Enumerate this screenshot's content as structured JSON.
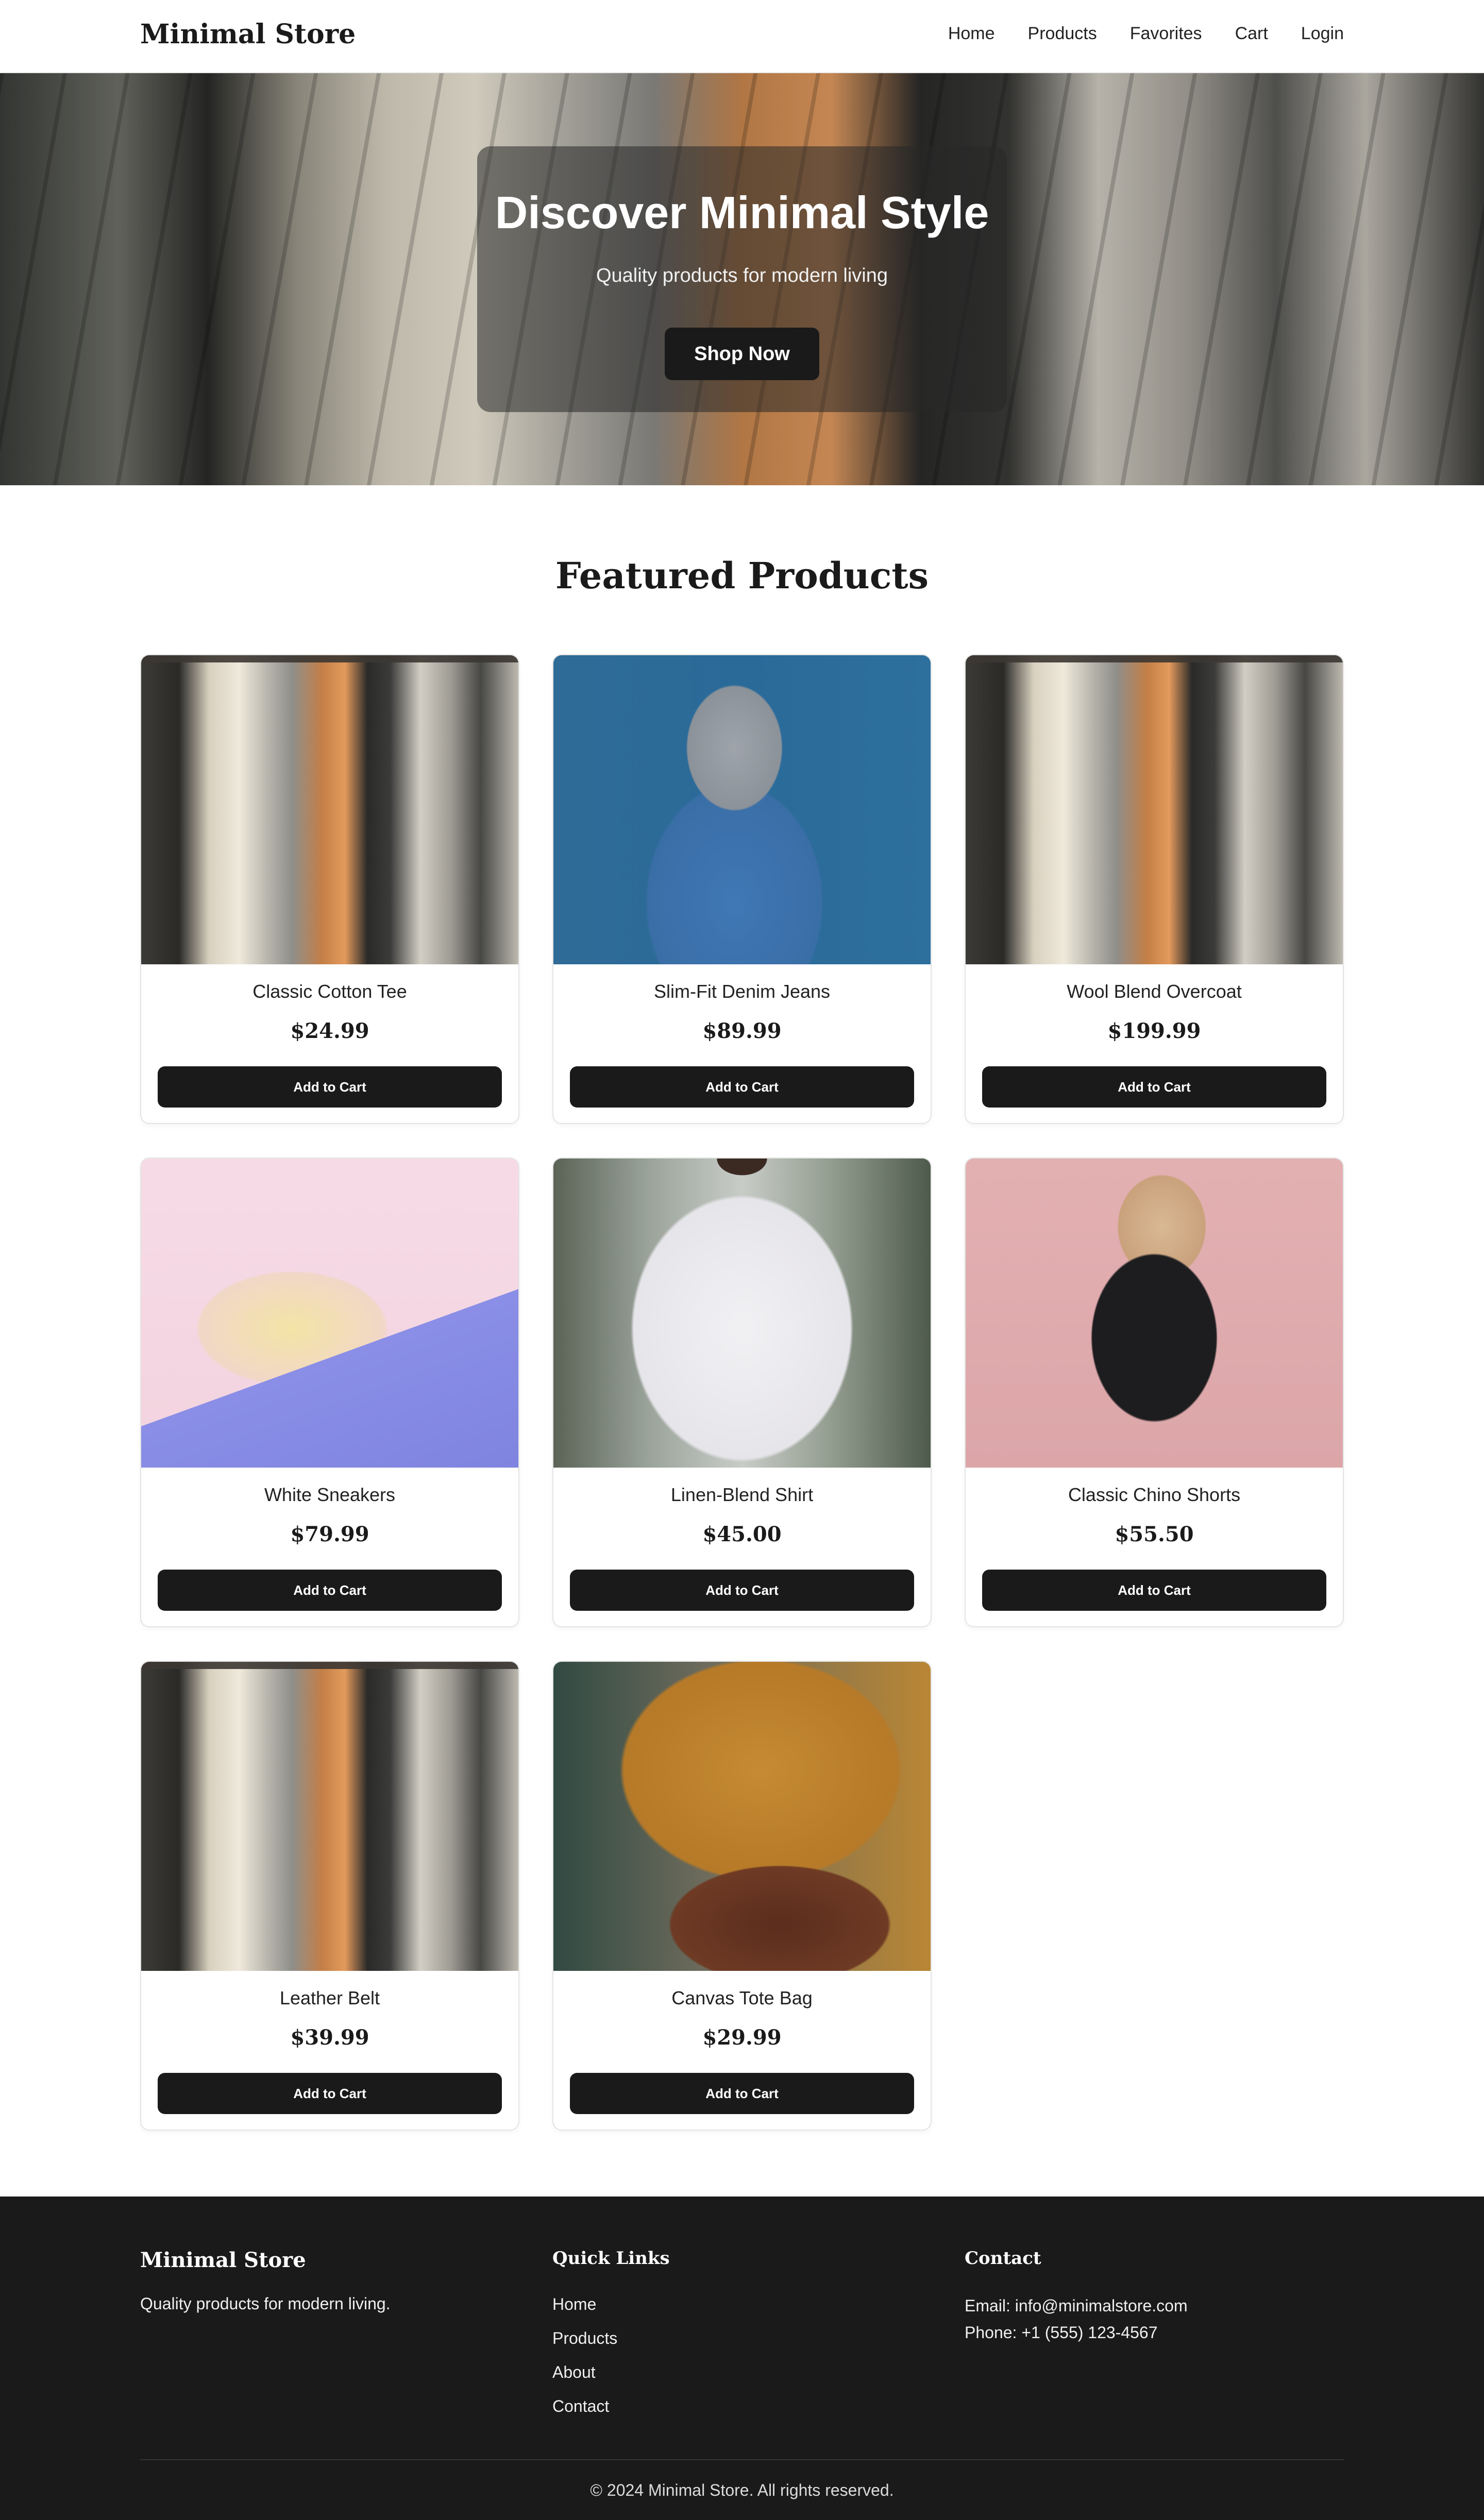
{
  "header": {
    "logo": "Minimal Store",
    "nav": [
      "Home",
      "Products",
      "Favorites",
      "Cart",
      "Login"
    ]
  },
  "hero": {
    "title": "Discover Minimal Style",
    "subtitle": "Quality products for modern living",
    "cta": "Shop Now"
  },
  "featured": {
    "title": "Featured Products",
    "products": [
      {
        "name": "Classic Cotton Tee",
        "price": "$24.99",
        "button": "Add to Cart"
      },
      {
        "name": "Slim-Fit Denim Jeans",
        "price": "$89.99",
        "button": "Add to Cart"
      },
      {
        "name": "Wool Blend Overcoat",
        "price": "$199.99",
        "button": "Add to Cart"
      },
      {
        "name": "White Sneakers",
        "price": "$79.99",
        "button": "Add to Cart"
      },
      {
        "name": "Linen-Blend Shirt",
        "price": "$45.00",
        "button": "Add to Cart"
      },
      {
        "name": "Classic Chino Shorts",
        "price": "$55.50",
        "button": "Add to Cart"
      },
      {
        "name": "Leather Belt",
        "price": "$39.99",
        "button": "Add to Cart"
      },
      {
        "name": "Canvas Tote Bag",
        "price": "$29.99",
        "button": "Add to Cart"
      }
    ]
  },
  "footer": {
    "brand": "Minimal Store",
    "tagline": "Quality products for modern living.",
    "quick_links_title": "Quick Links",
    "quick_links": [
      "Home",
      "Products",
      "About",
      "Contact"
    ],
    "contact_title": "Contact",
    "email": "Email: info@minimalstore.com",
    "phone": "Phone: +1 (555) 123-4567",
    "copyright": "© 2024 Minimal Store. All rights reserved."
  },
  "colors": {
    "primary": "#1a1a1a",
    "background": "#ffffff",
    "footer_bg": "#1a1a1a"
  }
}
